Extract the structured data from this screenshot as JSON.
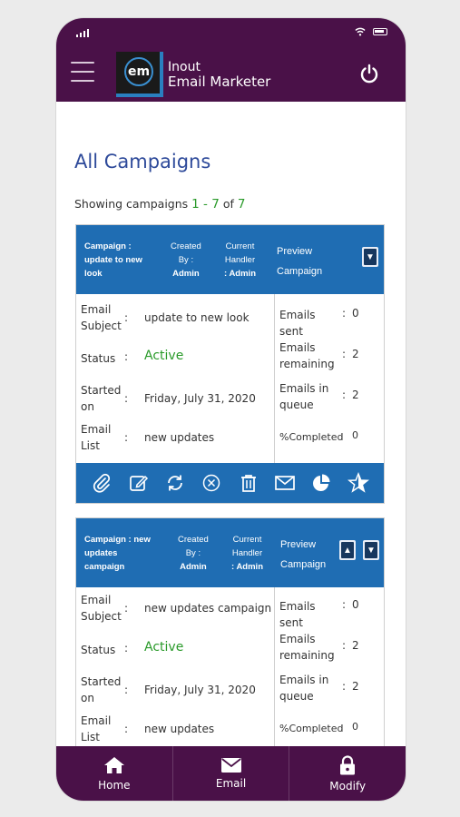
{
  "app": {
    "logo_text": "em",
    "brand_line1": "Inout",
    "brand_line2": "Email Marketer"
  },
  "page": {
    "title": "All Campaigns",
    "showing_prefix": "Showing campaigns",
    "range_start": "1",
    "range_sep": " - ",
    "range_end": "7",
    "of_text": "of",
    "total": "7"
  },
  "labels": {
    "created": "Created",
    "by": "By :",
    "current": "Current",
    "handler": "Handler",
    "preview": "Preview",
    "campaign": "Campaign",
    "email": "Email",
    "subject": "Subject",
    "status": "Status",
    "started": "Started",
    "on": "on",
    "list": "List",
    "emails_sent": "Emails sent",
    "emails": "Emails",
    "remaining": "remaining",
    "emails_in": "Emails in",
    "queue": "queue",
    "completed": "%Completed"
  },
  "campaigns": [
    {
      "name_l1": "Campaign :",
      "name_l2": "update to new",
      "name_l3": "look",
      "created_by": "Admin",
      "handler": ": Admin",
      "subject": "update to new look",
      "status": "Active",
      "started_on": "Friday, July 31, 2020",
      "email_list": "new updates",
      "emails_sent": "0",
      "emails_remaining": "2",
      "emails_in_queue": "2",
      "completed": "0"
    },
    {
      "name_l1": "Campaign : new",
      "name_l2": "updates",
      "name_l3": "campaign",
      "created_by": "Admin",
      "handler": ": Admin",
      "subject": "new updates campaign",
      "status": "Active",
      "started_on": "Friday, July 31, 2020",
      "email_list": "new updates",
      "emails_sent": "0",
      "emails_remaining": "2",
      "emails_in_queue": "2",
      "completed": "0"
    }
  ],
  "bottom_nav": [
    {
      "label": "Home",
      "icon": "home-icon"
    },
    {
      "label": "Email",
      "icon": "envelope-icon"
    },
    {
      "label": "Modify",
      "icon": "lock-icon"
    }
  ],
  "colors": {
    "header": "#4a1148",
    "card_header": "#1f6db3",
    "title": "#2e4a9a",
    "active": "#2a9a2a"
  }
}
